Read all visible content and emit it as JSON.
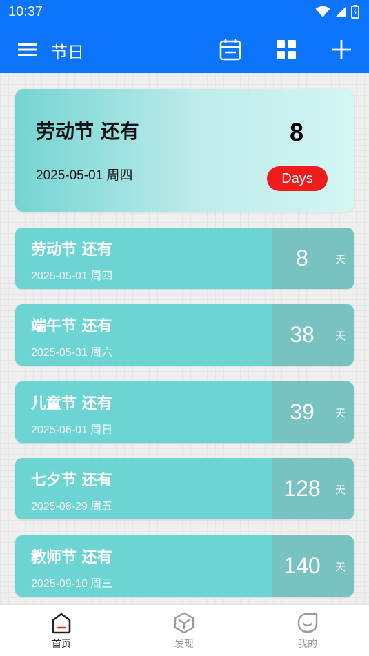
{
  "status_bar": {
    "time": "10:37"
  },
  "app_bar": {
    "title": "节日",
    "menu_icon": "hamburger-menu-icon",
    "actions": [
      "calendar-icon",
      "grid-icon",
      "plus-icon"
    ]
  },
  "hero": {
    "title": "劳动节 还有",
    "date": "2025-05-01  周四",
    "days": "8",
    "badge": "Days"
  },
  "festivals": [
    {
      "title": "劳动节 还有",
      "date": "2025-05-01  周四",
      "days": "8",
      "unit": "天"
    },
    {
      "title": "端午节 还有",
      "date": "2025-05-31  周六",
      "days": "38",
      "unit": "天"
    },
    {
      "title": "儿童节 还有",
      "date": "2025-06-01  周日",
      "days": "39",
      "unit": "天"
    },
    {
      "title": "七夕节 还有",
      "date": "2025-08-29  周五",
      "days": "128",
      "unit": "天"
    },
    {
      "title": "教师节 还有",
      "date": "2025-09-10  周三",
      "days": "140",
      "unit": "天"
    }
  ],
  "bottom_nav": [
    {
      "label": "首页",
      "icon": "home-icon",
      "active": true
    },
    {
      "label": "发现",
      "icon": "discover-cube-icon",
      "active": false
    },
    {
      "label": "我的",
      "icon": "profile-smile-icon",
      "active": false
    }
  ],
  "colors": {
    "primary": "#0c73fb",
    "teal": "#6cd5d3",
    "teal_dark": "#78c3c1",
    "badge_red": "#f21b1b",
    "nav_active": "#222222",
    "nav_inactive": "#9a9a9a"
  }
}
